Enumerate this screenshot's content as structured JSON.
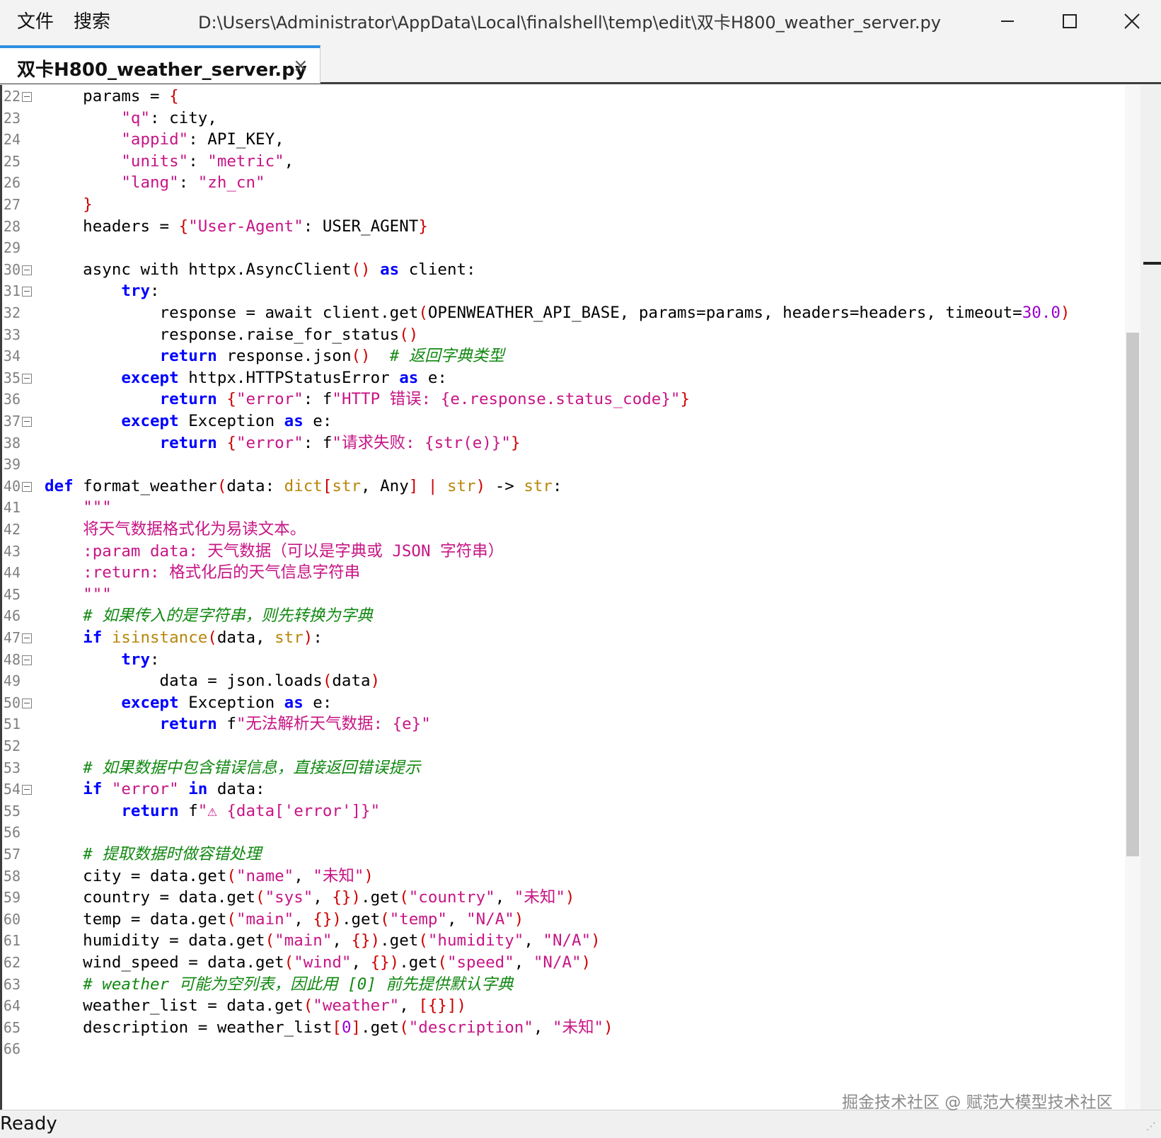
{
  "menu": [
    "文件",
    "搜索"
  ],
  "window": {
    "title_path": "D:\\Users\\Administrator\\AppData\\Local\\finalshell\\temp\\edit\\双卡H800_weather_server.py"
  },
  "tab": {
    "label": "双卡H800_weather_server.py",
    "close": "×"
  },
  "status": "Ready",
  "watermark": "掘金技术社区 @ 赋范大模型技术社区",
  "colors": {
    "keyword": "#0000ff",
    "string": "#c71585",
    "comment": "#118811",
    "number": "#9900cc",
    "operator": "#cc0000",
    "tab_accent": "#2f8fe0"
  },
  "lines": [
    {
      "n": "22",
      "fold": true,
      "tokens": [
        [
          "plain",
          "    params = "
        ],
        [
          "op",
          "{"
        ]
      ]
    },
    {
      "n": "23",
      "fold": false,
      "tokens": [
        [
          "plain",
          "        "
        ],
        [
          "str",
          "\"q\""
        ],
        [
          "plain",
          ": city,"
        ]
      ]
    },
    {
      "n": "24",
      "fold": false,
      "tokens": [
        [
          "plain",
          "        "
        ],
        [
          "str",
          "\"appid\""
        ],
        [
          "plain",
          ": API_KEY,"
        ]
      ]
    },
    {
      "n": "25",
      "fold": false,
      "tokens": [
        [
          "plain",
          "        "
        ],
        [
          "str",
          "\"units\""
        ],
        [
          "plain",
          ": "
        ],
        [
          "str",
          "\"metric\""
        ],
        [
          "plain",
          ","
        ]
      ]
    },
    {
      "n": "26",
      "fold": false,
      "tokens": [
        [
          "plain",
          "        "
        ],
        [
          "str",
          "\"lang\""
        ],
        [
          "plain",
          ": "
        ],
        [
          "str",
          "\"zh_cn\""
        ]
      ]
    },
    {
      "n": "27",
      "fold": false,
      "tokens": [
        [
          "plain",
          "    "
        ],
        [
          "op",
          "}"
        ]
      ]
    },
    {
      "n": "28",
      "fold": false,
      "tokens": [
        [
          "plain",
          "    headers = "
        ],
        [
          "op",
          "{"
        ],
        [
          "str",
          "\"User-Agent\""
        ],
        [
          "plain",
          ": USER_AGENT"
        ],
        [
          "op",
          "}"
        ]
      ]
    },
    {
      "n": "29",
      "fold": false,
      "tokens": []
    },
    {
      "n": "30",
      "fold": true,
      "tokens": [
        [
          "plain",
          "    async with httpx.AsyncClient"
        ],
        [
          "op",
          "()"
        ],
        [
          "plain",
          " "
        ],
        [
          "kw",
          "as"
        ],
        [
          "plain",
          " client:"
        ]
      ]
    },
    {
      "n": "31",
      "fold": true,
      "tokens": [
        [
          "plain",
          "        "
        ],
        [
          "kw",
          "try"
        ],
        [
          "plain",
          ":"
        ]
      ]
    },
    {
      "n": "32",
      "fold": false,
      "tokens": [
        [
          "plain",
          "            response = await client.get"
        ],
        [
          "op",
          "("
        ],
        [
          "plain",
          "OPENWEATHER_API_BASE, params=params, headers=headers, timeout="
        ],
        [
          "num",
          "30.0"
        ],
        [
          "op",
          ")"
        ]
      ]
    },
    {
      "n": "33",
      "fold": false,
      "tokens": [
        [
          "plain",
          "            response.raise_for_status"
        ],
        [
          "op",
          "()"
        ]
      ]
    },
    {
      "n": "34",
      "fold": false,
      "tokens": [
        [
          "plain",
          "            "
        ],
        [
          "kw",
          "return"
        ],
        [
          "plain",
          " response.json"
        ],
        [
          "op",
          "()"
        ],
        [
          "plain",
          "  "
        ],
        [
          "cm",
          "# 返回字典类型"
        ]
      ]
    },
    {
      "n": "35",
      "fold": true,
      "tokens": [
        [
          "plain",
          "        "
        ],
        [
          "kw",
          "except"
        ],
        [
          "plain",
          " httpx.HTTPStatusError "
        ],
        [
          "kw",
          "as"
        ],
        [
          "plain",
          " e:"
        ]
      ]
    },
    {
      "n": "36",
      "fold": false,
      "tokens": [
        [
          "plain",
          "            "
        ],
        [
          "kw",
          "return"
        ],
        [
          "plain",
          " "
        ],
        [
          "op",
          "{"
        ],
        [
          "str",
          "\"error\""
        ],
        [
          "plain",
          ": f"
        ],
        [
          "str",
          "\"HTTP 错误: {e.response.status_code}\""
        ],
        [
          "op",
          "}"
        ]
      ]
    },
    {
      "n": "37",
      "fold": true,
      "tokens": [
        [
          "plain",
          "        "
        ],
        [
          "kw",
          "except"
        ],
        [
          "plain",
          " Exception "
        ],
        [
          "kw",
          "as"
        ],
        [
          "plain",
          " e:"
        ]
      ]
    },
    {
      "n": "38",
      "fold": false,
      "tokens": [
        [
          "plain",
          "            "
        ],
        [
          "kw",
          "return"
        ],
        [
          "plain",
          " "
        ],
        [
          "op",
          "{"
        ],
        [
          "str",
          "\"error\""
        ],
        [
          "plain",
          ": f"
        ],
        [
          "str",
          "\"请求失败: {str(e)}\""
        ],
        [
          "op",
          "}"
        ]
      ]
    },
    {
      "n": "39",
      "fold": false,
      "tokens": []
    },
    {
      "n": "40",
      "fold": true,
      "tokens": [
        [
          "kw",
          "def"
        ],
        [
          "plain",
          " format_weather"
        ],
        [
          "op",
          "("
        ],
        [
          "plain",
          "data: "
        ],
        [
          "bi",
          "dict"
        ],
        [
          "op",
          "["
        ],
        [
          "bi",
          "str"
        ],
        [
          "plain",
          ", Any"
        ],
        [
          "op",
          "]"
        ],
        [
          "plain",
          " "
        ],
        [
          "op",
          "|"
        ],
        [
          "plain",
          " "
        ],
        [
          "bi",
          "str"
        ],
        [
          "op",
          ")"
        ],
        [
          "plain",
          " -> "
        ],
        [
          "bi",
          "str"
        ],
        [
          "plain",
          ":"
        ]
      ]
    },
    {
      "n": "41",
      "fold": false,
      "tokens": [
        [
          "plain",
          "    "
        ],
        [
          "str",
          "\"\"\""
        ]
      ]
    },
    {
      "n": "42",
      "fold": false,
      "tokens": [
        [
          "plain",
          "    "
        ],
        [
          "str",
          "将天气数据格式化为易读文本。"
        ]
      ]
    },
    {
      "n": "43",
      "fold": false,
      "tokens": [
        [
          "plain",
          "    "
        ],
        [
          "str",
          ":param data: 天气数据（可以是字典或 JSON 字符串）"
        ]
      ]
    },
    {
      "n": "44",
      "fold": false,
      "tokens": [
        [
          "plain",
          "    "
        ],
        [
          "str",
          ":return: 格式化后的天气信息字符串"
        ]
      ]
    },
    {
      "n": "45",
      "fold": false,
      "tokens": [
        [
          "plain",
          "    "
        ],
        [
          "str",
          "\"\"\""
        ]
      ]
    },
    {
      "n": "46",
      "fold": false,
      "tokens": [
        [
          "plain",
          "    "
        ],
        [
          "cm",
          "# 如果传入的是字符串，则先转换为字典"
        ]
      ]
    },
    {
      "n": "47",
      "fold": true,
      "tokens": [
        [
          "plain",
          "    "
        ],
        [
          "kw",
          "if"
        ],
        [
          "plain",
          " "
        ],
        [
          "bi",
          "isinstance"
        ],
        [
          "op",
          "("
        ],
        [
          "plain",
          "data, "
        ],
        [
          "bi",
          "str"
        ],
        [
          "op",
          ")"
        ],
        [
          "plain",
          ":"
        ]
      ]
    },
    {
      "n": "48",
      "fold": true,
      "tokens": [
        [
          "plain",
          "        "
        ],
        [
          "kw",
          "try"
        ],
        [
          "plain",
          ":"
        ]
      ]
    },
    {
      "n": "49",
      "fold": false,
      "tokens": [
        [
          "plain",
          "            data = json.loads"
        ],
        [
          "op",
          "("
        ],
        [
          "plain",
          "data"
        ],
        [
          "op",
          ")"
        ]
      ]
    },
    {
      "n": "50",
      "fold": true,
      "tokens": [
        [
          "plain",
          "        "
        ],
        [
          "kw",
          "except"
        ],
        [
          "plain",
          " Exception "
        ],
        [
          "kw",
          "as"
        ],
        [
          "plain",
          " e:"
        ]
      ]
    },
    {
      "n": "51",
      "fold": false,
      "tokens": [
        [
          "plain",
          "            "
        ],
        [
          "kw",
          "return"
        ],
        [
          "plain",
          " f"
        ],
        [
          "str",
          "\"无法解析天气数据: {e}\""
        ]
      ]
    },
    {
      "n": "52",
      "fold": false,
      "tokens": []
    },
    {
      "n": "53",
      "fold": false,
      "tokens": [
        [
          "plain",
          "    "
        ],
        [
          "cm",
          "# 如果数据中包含错误信息，直接返回错误提示"
        ]
      ]
    },
    {
      "n": "54",
      "fold": true,
      "tokens": [
        [
          "plain",
          "    "
        ],
        [
          "kw",
          "if"
        ],
        [
          "plain",
          " "
        ],
        [
          "str",
          "\"error\""
        ],
        [
          "plain",
          " "
        ],
        [
          "kw",
          "in"
        ],
        [
          "plain",
          " data:"
        ]
      ]
    },
    {
      "n": "55",
      "fold": false,
      "tokens": [
        [
          "plain",
          "        "
        ],
        [
          "kw",
          "return"
        ],
        [
          "plain",
          " f"
        ],
        [
          "str",
          "\"⚠ {data['error']}\""
        ]
      ]
    },
    {
      "n": "56",
      "fold": false,
      "tokens": []
    },
    {
      "n": "57",
      "fold": false,
      "tokens": [
        [
          "plain",
          "    "
        ],
        [
          "cm",
          "# 提取数据时做容错处理"
        ]
      ]
    },
    {
      "n": "58",
      "fold": false,
      "tokens": [
        [
          "plain",
          "    city = data.get"
        ],
        [
          "op",
          "("
        ],
        [
          "str",
          "\"name\""
        ],
        [
          "plain",
          ", "
        ],
        [
          "str",
          "\"未知\""
        ],
        [
          "op",
          ")"
        ]
      ]
    },
    {
      "n": "59",
      "fold": false,
      "tokens": [
        [
          "plain",
          "    country = data.get"
        ],
        [
          "op",
          "("
        ],
        [
          "str",
          "\"sys\""
        ],
        [
          "plain",
          ", "
        ],
        [
          "op",
          "{})"
        ],
        [
          "plain",
          ".get"
        ],
        [
          "op",
          "("
        ],
        [
          "str",
          "\"country\""
        ],
        [
          "plain",
          ", "
        ],
        [
          "str",
          "\"未知\""
        ],
        [
          "op",
          ")"
        ]
      ]
    },
    {
      "n": "60",
      "fold": false,
      "tokens": [
        [
          "plain",
          "    temp = data.get"
        ],
        [
          "op",
          "("
        ],
        [
          "str",
          "\"main\""
        ],
        [
          "plain",
          ", "
        ],
        [
          "op",
          "{})"
        ],
        [
          "plain",
          ".get"
        ],
        [
          "op",
          "("
        ],
        [
          "str",
          "\"temp\""
        ],
        [
          "plain",
          ", "
        ],
        [
          "str",
          "\"N/A\""
        ],
        [
          "op",
          ")"
        ]
      ]
    },
    {
      "n": "61",
      "fold": false,
      "tokens": [
        [
          "plain",
          "    humidity = data.get"
        ],
        [
          "op",
          "("
        ],
        [
          "str",
          "\"main\""
        ],
        [
          "plain",
          ", "
        ],
        [
          "op",
          "{})"
        ],
        [
          "plain",
          ".get"
        ],
        [
          "op",
          "("
        ],
        [
          "str",
          "\"humidity\""
        ],
        [
          "plain",
          ", "
        ],
        [
          "str",
          "\"N/A\""
        ],
        [
          "op",
          ")"
        ]
      ]
    },
    {
      "n": "62",
      "fold": false,
      "tokens": [
        [
          "plain",
          "    wind_speed = data.get"
        ],
        [
          "op",
          "("
        ],
        [
          "str",
          "\"wind\""
        ],
        [
          "plain",
          ", "
        ],
        [
          "op",
          "{})"
        ],
        [
          "plain",
          ".get"
        ],
        [
          "op",
          "("
        ],
        [
          "str",
          "\"speed\""
        ],
        [
          "plain",
          ", "
        ],
        [
          "str",
          "\"N/A\""
        ],
        [
          "op",
          ")"
        ]
      ]
    },
    {
      "n": "63",
      "fold": false,
      "tokens": [
        [
          "plain",
          "    "
        ],
        [
          "cm",
          "# weather 可能为空列表，因此用 [0] 前先提供默认字典"
        ]
      ]
    },
    {
      "n": "64",
      "fold": false,
      "tokens": [
        [
          "plain",
          "    weather_list = data.get"
        ],
        [
          "op",
          "("
        ],
        [
          "str",
          "\"weather\""
        ],
        [
          "plain",
          ", "
        ],
        [
          "op",
          "[{}])"
        ]
      ]
    },
    {
      "n": "65",
      "fold": false,
      "tokens": [
        [
          "plain",
          "    description = weather_list"
        ],
        [
          "op",
          "["
        ],
        [
          "num",
          "0"
        ],
        [
          "op",
          "]"
        ],
        [
          "plain",
          ".get"
        ],
        [
          "op",
          "("
        ],
        [
          "str",
          "\"description\""
        ],
        [
          "plain",
          ", "
        ],
        [
          "str",
          "\"未知\""
        ],
        [
          "op",
          ")"
        ]
      ]
    },
    {
      "n": "66",
      "fold": false,
      "tokens": []
    }
  ]
}
